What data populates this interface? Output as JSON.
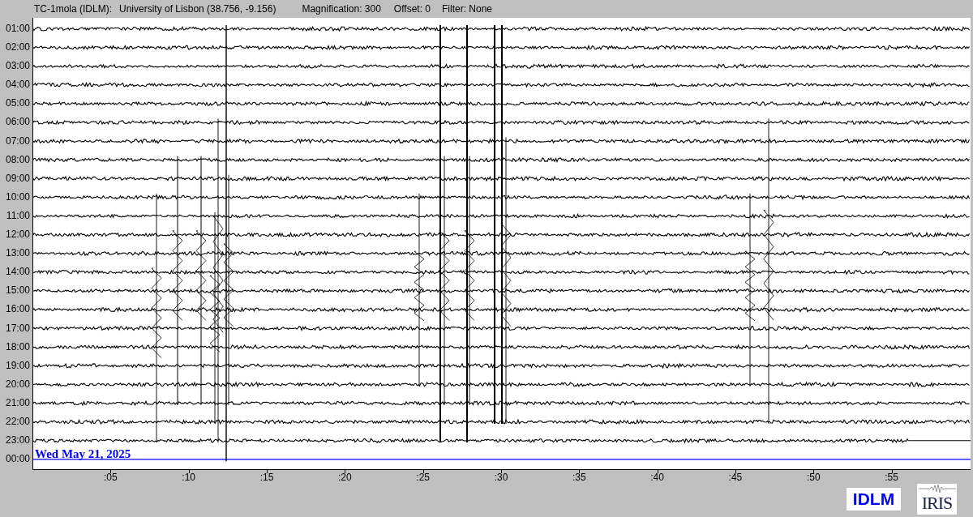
{
  "header": {
    "station": "TC-1mola (IDLM):",
    "location": "University of Lisbon (38.756, -9.156)",
    "magnification": "Magnification: 300",
    "offset": "Offset: 0",
    "filter": "Filter: None"
  },
  "rows": [
    {
      "label": "01:00",
      "kind": "trace"
    },
    {
      "label": "02:00",
      "kind": "trace"
    },
    {
      "label": "03:00",
      "kind": "trace"
    },
    {
      "label": "04:00",
      "kind": "trace"
    },
    {
      "label": "05:00",
      "kind": "trace"
    },
    {
      "label": "06:00",
      "kind": "trace"
    },
    {
      "label": "07:00",
      "kind": "trace"
    },
    {
      "label": "08:00",
      "kind": "trace"
    },
    {
      "label": "09:00",
      "kind": "trace"
    },
    {
      "label": "10:00",
      "kind": "trace"
    },
    {
      "label": "11:00",
      "kind": "trace"
    },
    {
      "label": "12:00",
      "kind": "trace"
    },
    {
      "label": "13:00",
      "kind": "trace"
    },
    {
      "label": "14:00",
      "kind": "trace"
    },
    {
      "label": "15:00",
      "kind": "trace"
    },
    {
      "label": "16:00",
      "kind": "trace"
    },
    {
      "label": "17:00",
      "kind": "trace"
    },
    {
      "label": "18:00",
      "kind": "trace"
    },
    {
      "label": "19:00",
      "kind": "trace"
    },
    {
      "label": "20:00",
      "kind": "trace"
    },
    {
      "label": "21:00",
      "kind": "trace"
    },
    {
      "label": "22:00",
      "kind": "trace"
    },
    {
      "label": "23:00",
      "kind": "partial"
    },
    {
      "label": "00:00",
      "kind": "current"
    }
  ],
  "date": "Wed May 21, 2025",
  "x_ticks": [
    ":05",
    ":10",
    ":15",
    ":20",
    ":25",
    ":30",
    ":35",
    ":40",
    ":45",
    ":50",
    ":55"
  ],
  "logos": {
    "station": "IDLM",
    "network": "IRIS"
  }
}
